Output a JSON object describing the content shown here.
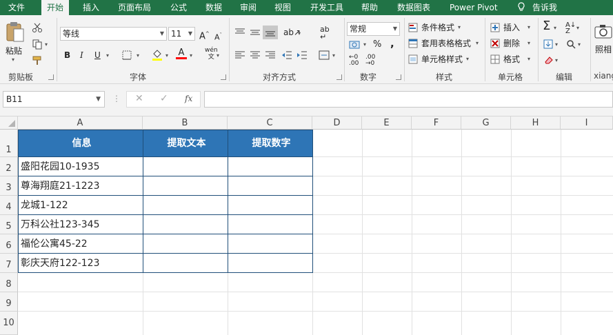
{
  "tabs": [
    "文件",
    "开始",
    "插入",
    "页面布局",
    "公式",
    "数据",
    "审阅",
    "视图",
    "开发工具",
    "帮助",
    "数据图表",
    "Power Pivot",
    "告诉我"
  ],
  "active_tab": "开始",
  "clipboard": {
    "paste_label": "粘贴",
    "group_label": "剪贴板"
  },
  "font": {
    "name": "等线",
    "size": "11",
    "group_label": "字体",
    "bold": "B",
    "italic": "I",
    "underline": "U"
  },
  "alignment": {
    "group_label": "对齐方式"
  },
  "number": {
    "format": "常规",
    "percent": "%",
    "comma": ",",
    "group_label": "数字"
  },
  "styles": {
    "conditional": "条件格式",
    "table_format": "套用表格格式",
    "cell_styles": "单元格样式",
    "group_label": "样式"
  },
  "cells": {
    "insert": "插入",
    "delete": "删除",
    "format": "格式",
    "group_label": "单元格"
  },
  "editing": {
    "group_label": "编辑"
  },
  "extra": {
    "label1": "照相",
    "label2": "xiang"
  },
  "namebox": "B11",
  "fx": "fx",
  "columns": [
    "A",
    "B",
    "C",
    "D",
    "E",
    "F",
    "G",
    "H",
    "I"
  ],
  "rows": [
    "1",
    "2",
    "3",
    "4",
    "5",
    "6",
    "7",
    "8",
    "9",
    "10"
  ],
  "table": {
    "headers": [
      "信息",
      "提取文本",
      "提取数字"
    ],
    "data": [
      "盛阳花园10-1935",
      "尊海翔庭21-1223",
      "龙城1-122",
      "万科公社123-345",
      "福伦公寓45-22",
      "彰庆天府122-123"
    ]
  },
  "colors": {
    "ribbon_green": "#217346",
    "header_blue": "#2e75b6"
  }
}
